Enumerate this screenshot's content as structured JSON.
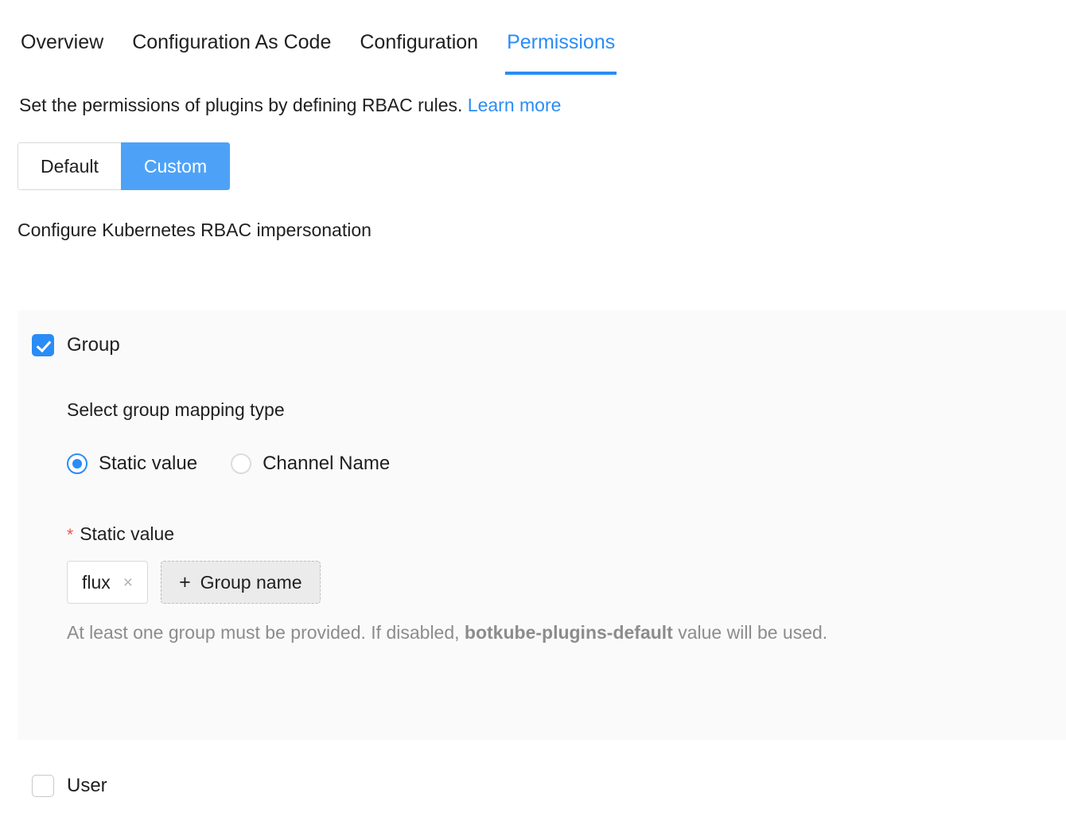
{
  "tabs": [
    {
      "label": "Overview",
      "active": false
    },
    {
      "label": "Configuration As Code",
      "active": false
    },
    {
      "label": "Configuration",
      "active": false
    },
    {
      "label": "Permissions",
      "active": true
    }
  ],
  "description": {
    "text": "Set the permissions of plugins by defining RBAC rules.",
    "link_label": "Learn more"
  },
  "mode_toggle": {
    "default_label": "Default",
    "custom_label": "Custom",
    "selected": "Custom"
  },
  "section": {
    "heading": "Configure Kubernetes RBAC impersonation"
  },
  "group": {
    "checkbox_label": "Group",
    "checked": true,
    "mapping": {
      "heading": "Select group mapping type",
      "options": [
        {
          "label": "Static value",
          "selected": true
        },
        {
          "label": "Channel Name",
          "selected": false
        }
      ]
    },
    "static_value": {
      "required_marker": "*",
      "label": "Static value",
      "tags": [
        {
          "text": "flux",
          "close_icon": "close-icon",
          "close_glyph": "×"
        }
      ],
      "add_button": {
        "plus_glyph": "+",
        "label": "Group name"
      },
      "help": {
        "before": "At least one group must be provided. If disabled,",
        "bold": "botkube-plugins-default",
        "after": "value will be used."
      }
    }
  },
  "user": {
    "checkbox_label": "User",
    "checked": false
  },
  "colors": {
    "accent": "#2a8cf7",
    "toggle_active": "#4da2f8",
    "panel_bg": "#fafafa",
    "required": "#f0544c",
    "muted_text": "#8c8c8c"
  }
}
